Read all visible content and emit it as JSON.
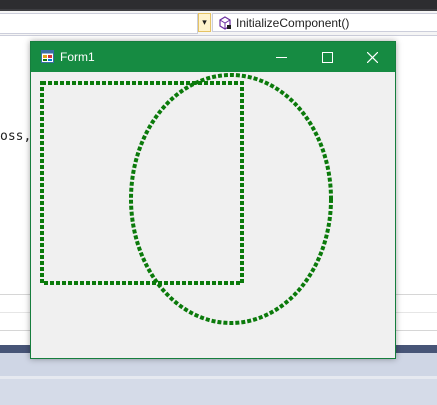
{
  "ide": {
    "navigation": {
      "dropdown_arrow": "▾",
      "method_name": "InitializeComponent()",
      "method_icon": "method-cube-icon"
    },
    "editor": {
      "code_fragment": "oss,"
    }
  },
  "form": {
    "title": "Form1",
    "app_icon": "windows-form-icon",
    "buttons": {
      "minimize": "minimize-icon",
      "maximize": "maximize-icon",
      "close": "close-icon"
    },
    "drawing": {
      "stroke_color": "#0b7a0b",
      "style": "dashed",
      "shapes": [
        "rectangle",
        "ellipse"
      ]
    }
  }
}
